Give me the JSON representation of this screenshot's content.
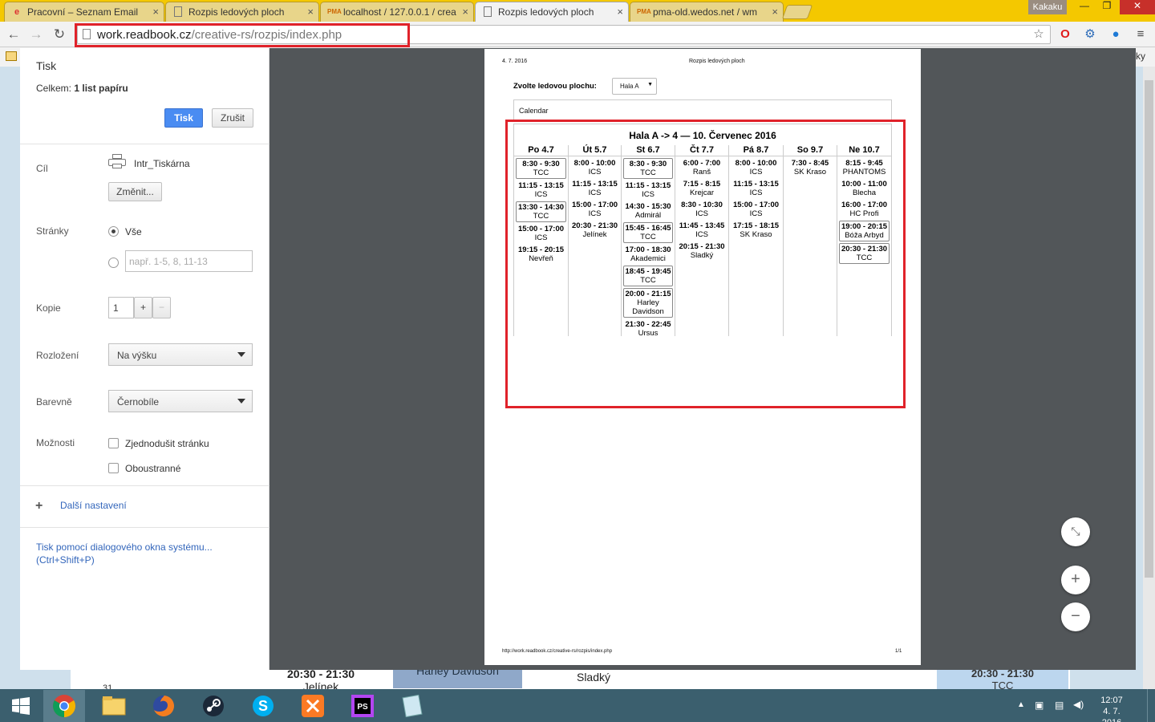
{
  "tabs": [
    {
      "label": "Pracovní – Seznam Email",
      "icon": "seznam-e-icon"
    },
    {
      "label": "Rozpis ledových ploch",
      "icon": "page-icon"
    },
    {
      "label": "localhost / 127.0.0.1 / crea",
      "icon": "phpmyadmin-icon"
    },
    {
      "label": "Rozpis ledových ploch",
      "icon": "page-icon"
    },
    {
      "label": "pma-old.wedos.net / wm",
      "icon": "phpmyadmin-icon"
    }
  ],
  "profile_name": "Kakaku",
  "address_bar": {
    "host": "work.readbook.cz",
    "path": "/creative-rs/rozpis/index.php"
  },
  "bookmarks_right": "žky",
  "print_dialog": {
    "title": "Tisk",
    "total_label": "Celkem:",
    "total_value": "1 list papíru",
    "print_button": "Tisk",
    "cancel_button": "Zrušit",
    "destination_label": "Cíl",
    "printer_name": "Intr_Tiskárna",
    "change_button": "Změnit...",
    "pages_label": "Stránky",
    "pages_all": "Vše",
    "pages_placeholder": "např. 1-5, 8, 11-13",
    "copies_label": "Kopie",
    "copies_value": "1",
    "layout_label": "Rozložení",
    "layout_value": "Na výšku",
    "color_label": "Barevně",
    "color_value": "Černobíle",
    "options_label": "Možnosti",
    "option_simplify": "Zjednodušit stránku",
    "option_duplex": "Oboustranné",
    "more_settings": "Další nastavení",
    "system_dialog": "Tisk pomocí dialogového okna systému... (Ctrl+Shift+P)"
  },
  "preview": {
    "date": "4. 7. 2016",
    "page_title": "Rozpis ledových ploch",
    "choose_label": "Zvolte ledovou plochu:",
    "hala_value": "Hala A",
    "calendar_label": "Calendar",
    "calendar_title": "Hala A -> 4 — 10. Červenec 2016",
    "footer_url": "http://work.readbook.cz/creative-rs/rozpis/index.php",
    "page_num": "1/1",
    "days": [
      {
        "name": "Po 4.7",
        "events": [
          {
            "time": "8:30 - 9:30",
            "name": "TCC",
            "boxed": true
          },
          {
            "time": "11:15 - 13:15",
            "name": "ICS",
            "boxed": false
          },
          {
            "time": "13:30 - 14:30",
            "name": "TCC",
            "boxed": true
          },
          {
            "time": "15:00 - 17:00",
            "name": "ICS",
            "boxed": false
          },
          {
            "time": "19:15 - 20:15",
            "name": "Nevřeň",
            "boxed": false
          }
        ]
      },
      {
        "name": "Út 5.7",
        "events": [
          {
            "time": "8:00 - 10:00",
            "name": "ICS",
            "boxed": false
          },
          {
            "time": "11:15 - 13:15",
            "name": "ICS",
            "boxed": false
          },
          {
            "time": "15:00 - 17:00",
            "name": "ICS",
            "boxed": false
          },
          {
            "time": "20:30 - 21:30",
            "name": "Jelínek",
            "boxed": false
          }
        ]
      },
      {
        "name": "St 6.7",
        "events": [
          {
            "time": "8:30 - 9:30",
            "name": "TCC",
            "boxed": true
          },
          {
            "time": "11:15 - 13:15",
            "name": "ICS",
            "boxed": false
          },
          {
            "time": "14:30 - 15:30",
            "name": "Admirál",
            "boxed": false
          },
          {
            "time": "15:45 - 16:45",
            "name": "TCC",
            "boxed": true
          },
          {
            "time": "17:00 - 18:30",
            "name": "Akademici",
            "boxed": false
          },
          {
            "time": "18:45 - 19:45",
            "name": "TCC",
            "boxed": true
          },
          {
            "time": "20:00 - 21:15",
            "name": "Harley Davidson",
            "boxed": true
          },
          {
            "time": "21:30 - 22:45",
            "name": "Ursus",
            "boxed": false
          }
        ]
      },
      {
        "name": "Čt 7.7",
        "events": [
          {
            "time": "6:00 - 7:00",
            "name": "Ranš",
            "boxed": false
          },
          {
            "time": "7:15 - 8:15",
            "name": "Krejcar",
            "boxed": false
          },
          {
            "time": "8:30 - 10:30",
            "name": "ICS",
            "boxed": false
          },
          {
            "time": "11:45 - 13:45",
            "name": "ICS",
            "boxed": false
          },
          {
            "time": "20:15 - 21:30",
            "name": "Sladký",
            "boxed": false
          }
        ]
      },
      {
        "name": "Pá 8.7",
        "events": [
          {
            "time": "8:00 - 10:00",
            "name": "ICS",
            "boxed": false
          },
          {
            "time": "11:15 - 13:15",
            "name": "ICS",
            "boxed": false
          },
          {
            "time": "15:00 - 17:00",
            "name": "ICS",
            "boxed": false
          },
          {
            "time": "17:15 - 18:15",
            "name": "SK Kraso",
            "boxed": false
          }
        ]
      },
      {
        "name": "So 9.7",
        "events": [
          {
            "time": "7:30 - 8:45",
            "name": "SK Kraso",
            "boxed": false
          }
        ]
      },
      {
        "name": "Ne 10.7",
        "events": [
          {
            "time": "8:15 - 9:45",
            "name": "PHANTOMS",
            "boxed": false
          },
          {
            "time": "10:00 - 11:00",
            "name": "Blecha",
            "boxed": false
          },
          {
            "time": "16:00 - 17:00",
            "name": "HC Profi",
            "boxed": false
          },
          {
            "time": "19:00 - 20:15",
            "name": "Bóža Arbyd",
            "boxed": true
          },
          {
            "time": "20:30 - 21:30",
            "name": "TCC",
            "boxed": true
          }
        ]
      }
    ]
  },
  "background_page": {
    "cell1_time": "20:30 - 21:30",
    "cell1_name": "Jelínek",
    "cell2_name": "Harley Davidson",
    "cell3_name": "Sladký",
    "cell4_time": "20:30 - 21:30",
    "cell4_name": "TCC",
    "row_num": "31"
  },
  "taskbar": {
    "time": "12:07",
    "date": "4. 7. 2016",
    "apps": [
      "start-icon",
      "chrome-icon",
      "file-explorer-icon",
      "firefox-icon",
      "steam-icon",
      "skype-icon",
      "xampp-icon",
      "phpstorm-icon",
      "notepad-icon"
    ]
  },
  "colors": {
    "highlight_red": "#e0222a",
    "print_blue": "#4a8cf2",
    "tab_bar_yellow": "#f4c800",
    "preview_gray": "#525659"
  }
}
